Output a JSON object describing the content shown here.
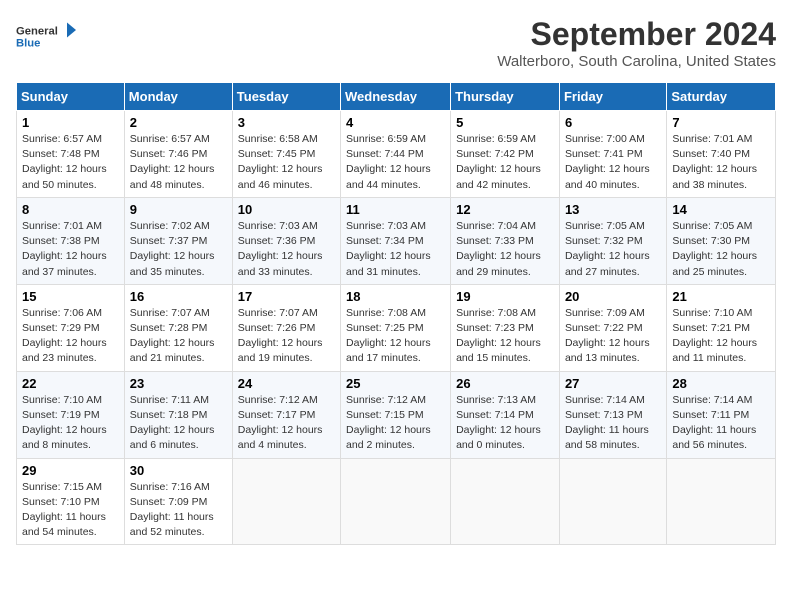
{
  "header": {
    "logo_line1": "General",
    "logo_line2": "Blue",
    "month_title": "September 2024",
    "location": "Walterboro, South Carolina, United States"
  },
  "weekdays": [
    "Sunday",
    "Monday",
    "Tuesday",
    "Wednesday",
    "Thursday",
    "Friday",
    "Saturday"
  ],
  "weeks": [
    [
      {
        "day": "1",
        "content": "Sunrise: 6:57 AM\nSunset: 7:48 PM\nDaylight: 12 hours\nand 50 minutes."
      },
      {
        "day": "2",
        "content": "Sunrise: 6:57 AM\nSunset: 7:46 PM\nDaylight: 12 hours\nand 48 minutes."
      },
      {
        "day": "3",
        "content": "Sunrise: 6:58 AM\nSunset: 7:45 PM\nDaylight: 12 hours\nand 46 minutes."
      },
      {
        "day": "4",
        "content": "Sunrise: 6:59 AM\nSunset: 7:44 PM\nDaylight: 12 hours\nand 44 minutes."
      },
      {
        "day": "5",
        "content": "Sunrise: 6:59 AM\nSunset: 7:42 PM\nDaylight: 12 hours\nand 42 minutes."
      },
      {
        "day": "6",
        "content": "Sunrise: 7:00 AM\nSunset: 7:41 PM\nDaylight: 12 hours\nand 40 minutes."
      },
      {
        "day": "7",
        "content": "Sunrise: 7:01 AM\nSunset: 7:40 PM\nDaylight: 12 hours\nand 38 minutes."
      }
    ],
    [
      {
        "day": "8",
        "content": "Sunrise: 7:01 AM\nSunset: 7:38 PM\nDaylight: 12 hours\nand 37 minutes."
      },
      {
        "day": "9",
        "content": "Sunrise: 7:02 AM\nSunset: 7:37 PM\nDaylight: 12 hours\nand 35 minutes."
      },
      {
        "day": "10",
        "content": "Sunrise: 7:03 AM\nSunset: 7:36 PM\nDaylight: 12 hours\nand 33 minutes."
      },
      {
        "day": "11",
        "content": "Sunrise: 7:03 AM\nSunset: 7:34 PM\nDaylight: 12 hours\nand 31 minutes."
      },
      {
        "day": "12",
        "content": "Sunrise: 7:04 AM\nSunset: 7:33 PM\nDaylight: 12 hours\nand 29 minutes."
      },
      {
        "day": "13",
        "content": "Sunrise: 7:05 AM\nSunset: 7:32 PM\nDaylight: 12 hours\nand 27 minutes."
      },
      {
        "day": "14",
        "content": "Sunrise: 7:05 AM\nSunset: 7:30 PM\nDaylight: 12 hours\nand 25 minutes."
      }
    ],
    [
      {
        "day": "15",
        "content": "Sunrise: 7:06 AM\nSunset: 7:29 PM\nDaylight: 12 hours\nand 23 minutes."
      },
      {
        "day": "16",
        "content": "Sunrise: 7:07 AM\nSunset: 7:28 PM\nDaylight: 12 hours\nand 21 minutes."
      },
      {
        "day": "17",
        "content": "Sunrise: 7:07 AM\nSunset: 7:26 PM\nDaylight: 12 hours\nand 19 minutes."
      },
      {
        "day": "18",
        "content": "Sunrise: 7:08 AM\nSunset: 7:25 PM\nDaylight: 12 hours\nand 17 minutes."
      },
      {
        "day": "19",
        "content": "Sunrise: 7:08 AM\nSunset: 7:23 PM\nDaylight: 12 hours\nand 15 minutes."
      },
      {
        "day": "20",
        "content": "Sunrise: 7:09 AM\nSunset: 7:22 PM\nDaylight: 12 hours\nand 13 minutes."
      },
      {
        "day": "21",
        "content": "Sunrise: 7:10 AM\nSunset: 7:21 PM\nDaylight: 12 hours\nand 11 minutes."
      }
    ],
    [
      {
        "day": "22",
        "content": "Sunrise: 7:10 AM\nSunset: 7:19 PM\nDaylight: 12 hours\nand 8 minutes."
      },
      {
        "day": "23",
        "content": "Sunrise: 7:11 AM\nSunset: 7:18 PM\nDaylight: 12 hours\nand 6 minutes."
      },
      {
        "day": "24",
        "content": "Sunrise: 7:12 AM\nSunset: 7:17 PM\nDaylight: 12 hours\nand 4 minutes."
      },
      {
        "day": "25",
        "content": "Sunrise: 7:12 AM\nSunset: 7:15 PM\nDaylight: 12 hours\nand 2 minutes."
      },
      {
        "day": "26",
        "content": "Sunrise: 7:13 AM\nSunset: 7:14 PM\nDaylight: 12 hours\nand 0 minutes."
      },
      {
        "day": "27",
        "content": "Sunrise: 7:14 AM\nSunset: 7:13 PM\nDaylight: 11 hours\nand 58 minutes."
      },
      {
        "day": "28",
        "content": "Sunrise: 7:14 AM\nSunset: 7:11 PM\nDaylight: 11 hours\nand 56 minutes."
      }
    ],
    [
      {
        "day": "29",
        "content": "Sunrise: 7:15 AM\nSunset: 7:10 PM\nDaylight: 11 hours\nand 54 minutes."
      },
      {
        "day": "30",
        "content": "Sunrise: 7:16 AM\nSunset: 7:09 PM\nDaylight: 11 hours\nand 52 minutes."
      },
      {
        "day": "",
        "content": ""
      },
      {
        "day": "",
        "content": ""
      },
      {
        "day": "",
        "content": ""
      },
      {
        "day": "",
        "content": ""
      },
      {
        "day": "",
        "content": ""
      }
    ]
  ]
}
